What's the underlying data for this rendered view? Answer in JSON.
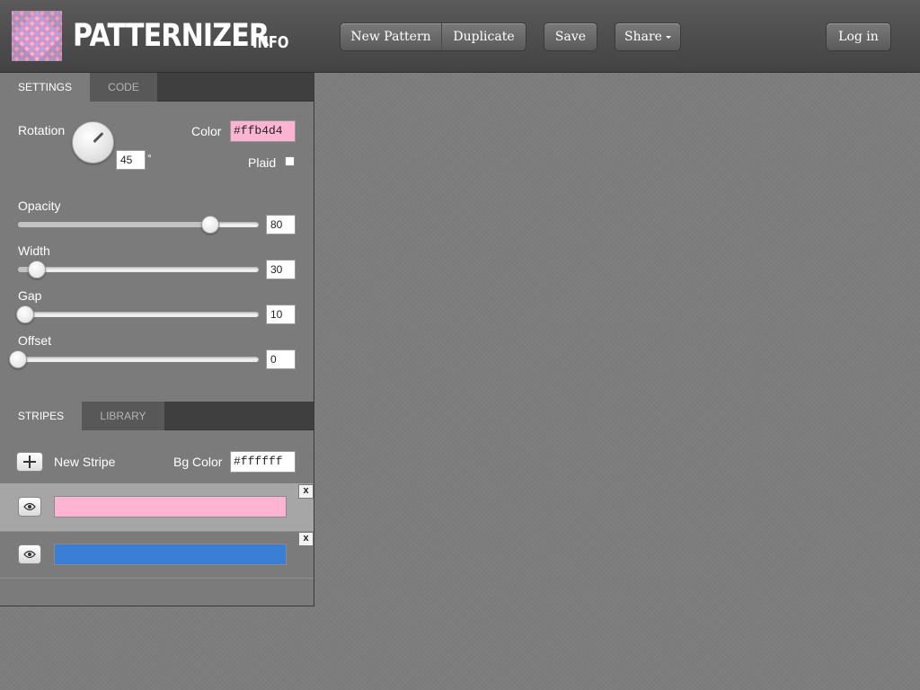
{
  "app": {
    "logo_text": "PATTERNIZER",
    "info_label": "INFO"
  },
  "toolbar": {
    "new_pattern_label": "New Pattern",
    "duplicate_label": "Duplicate",
    "save_label": "Save",
    "share_label": "Share",
    "login_label": "Log in"
  },
  "settings_tabs": [
    {
      "label": "SETTINGS",
      "active": true
    },
    {
      "label": "CODE",
      "active": false
    }
  ],
  "settings": {
    "rotation_label": "Rotation",
    "rotation_value": "45",
    "degree_symbol": "°",
    "color_label": "Color",
    "color_value": "#ffb4d4",
    "plaid_label": "Plaid",
    "plaid_checked": false,
    "sliders": [
      {
        "label": "Opacity",
        "value": "80",
        "fraction": 0.8
      },
      {
        "label": "Width",
        "value": "30",
        "fraction": 0.08
      },
      {
        "label": "Gap",
        "value": "10",
        "fraction": 0.03
      },
      {
        "label": "Offset",
        "value": "0",
        "fraction": 0.0
      }
    ]
  },
  "stripe_tabs": [
    {
      "label": "STRIPES",
      "active": true
    },
    {
      "label": "LIBRARY",
      "active": false
    }
  ],
  "stripes_panel": {
    "new_stripe_label": "New Stripe",
    "bg_color_label": "Bg Color",
    "bg_color_value": "#ffffff",
    "close_label": "x",
    "stripes": [
      {
        "color": "#ffb4d4",
        "selected": true
      },
      {
        "color": "#3a7fd5",
        "selected": false
      }
    ]
  },
  "icons": {
    "logo": "patternizer-logo-icon",
    "add": "plus-icon",
    "eye": "eye-icon",
    "caret": "caret-down-icon"
  },
  "colors": {
    "topbar": "#4a4a4a",
    "panel": "#7b7b7b",
    "canvas": "#7d7d7d",
    "tab_dark": "#3f3f3f"
  }
}
